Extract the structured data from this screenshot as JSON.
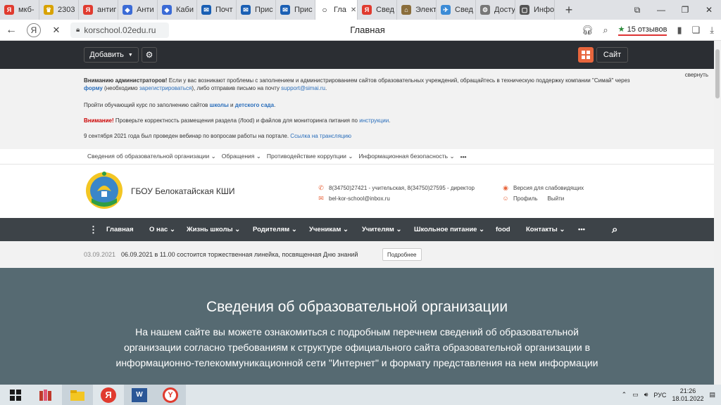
{
  "browser": {
    "tabs": [
      {
        "label": "мкб-",
        "icon": "yandex-icon",
        "color": "#e03b2f"
      },
      {
        "label": "2303",
        "icon": "crest-icon",
        "color": "#d8a200"
      },
      {
        "label": "антиг",
        "icon": "yandex-icon",
        "color": "#e03b2f"
      },
      {
        "label": "Анти",
        "icon": "shield-icon",
        "color": "#3b6bd6"
      },
      {
        "label": "Каби",
        "icon": "shield-icon",
        "color": "#3b6bd6"
      },
      {
        "label": "Почт",
        "icon": "mail-icon",
        "color": "#1a5fb4"
      },
      {
        "label": "Прис",
        "icon": "mail-icon",
        "color": "#1a5fb4"
      },
      {
        "label": "Прис",
        "icon": "mail-icon",
        "color": "#1a5fb4"
      },
      {
        "label": "Гла",
        "icon": "loading-icon",
        "color": "#222222",
        "active": true
      },
      {
        "label": "Свед",
        "icon": "yandex-icon",
        "color": "#e03b2f"
      },
      {
        "label": "Элект",
        "icon": "school-icon",
        "color": "#8a6d3b"
      },
      {
        "label": "Свед",
        "icon": "plane-icon",
        "color": "#3b8bd6"
      },
      {
        "label": "Досту",
        "icon": "gear-icon",
        "color": "#777777"
      },
      {
        "label": "Инфо",
        "icon": "doc-icon",
        "color": "#555555"
      }
    ],
    "url": "korschool.02edu.ru",
    "page_title": "Главная",
    "reviews": "15 отзывов"
  },
  "admin": {
    "add_label": "Добавить",
    "site_label": "Сайт"
  },
  "notice": {
    "collapse": "свернуть",
    "p1_bold": "Вниманию администраторов!",
    "p1_text1": " Если у вас возникают проблемы с заполнением и администрированием сайтов образовательных учреждений, обращайтесь в техническую поддержку компании \"Симай\" через ",
    "p1_link1": "форму",
    "p1_text2": " (необходимо ",
    "p1_link2": "зарегистрироваться",
    "p1_text3": "), либо отправив письмо на почту ",
    "p1_link3": "support@simai.ru",
    "p1_text4": ".",
    "p2_text1": "Пройти обучающий курс по заполнению сайтов ",
    "p2_link1": "школы",
    "p2_text2": " и ",
    "p2_link2": "детского сада",
    "p2_text3": ".",
    "p3_bold": "Внимание!",
    "p3_text1": " Проверьте корректность размещения раздела (/food) и файлов для мониторинга питания по ",
    "p3_link1": "инструкции",
    "p3_text2": ".",
    "p4_text1": "9 сентября 2021 года был проведен вебинар по вопросам работы на портале. ",
    "p4_link1": "Ссылка на трансляцию"
  },
  "infomenu": [
    "Сведения об образовательной организации",
    "Обращения",
    "Противодействие коррупции",
    "Информационная безопасность"
  ],
  "header": {
    "school_name": "ГБОУ Белокатайская КШИ",
    "phone": "8(34750)27421 - учительская, 8(34750)27595 - директор",
    "email": "bel-kor-school@inbox.ru",
    "vision": "Версия для слабовидящих",
    "profile": "Профиль",
    "logout": "Выйти"
  },
  "mainnav": [
    {
      "label": "Главная",
      "dropdown": false
    },
    {
      "label": "О нас",
      "dropdown": true
    },
    {
      "label": "Жизнь школы",
      "dropdown": true
    },
    {
      "label": "Родителям",
      "dropdown": true
    },
    {
      "label": "Ученикам",
      "dropdown": true
    },
    {
      "label": "Учителям",
      "dropdown": true
    },
    {
      "label": "Школьное питание",
      "dropdown": true
    },
    {
      "label": "food",
      "dropdown": false
    },
    {
      "label": "Контакты",
      "dropdown": true
    }
  ],
  "ticker": {
    "date": "03.09.2021",
    "text": "06.09.2021 в 11.00 состоится торжественная линейка, посвященная Дню знаний",
    "more": "Подробнее"
  },
  "hero": {
    "title": "Сведения об образовательной организации",
    "lead": "На нашем сайте вы можете ознакомиться с подробным перечнем сведений об образовательной организации согласно требованиям к структуре официального сайта образовательной организации в информационно-телекоммуникационной сети \"Интернет\" и формату представления на нем информации"
  },
  "taskbar": {
    "lang": "РУС",
    "time": "21:26",
    "date": "18.01.2022"
  },
  "colors": {
    "accent": "#e8663d",
    "admin_bg": "#2b2e33",
    "nav_bg": "#3d4348",
    "hero_bg": "#566a72"
  }
}
